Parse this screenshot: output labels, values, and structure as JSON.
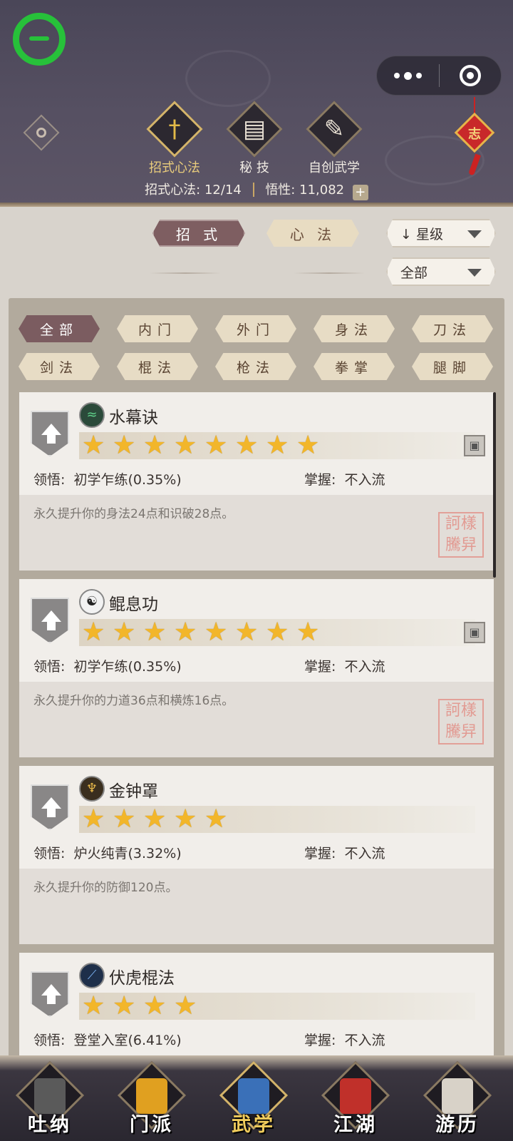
{
  "header": {
    "tabs": [
      {
        "label": "招式心法",
        "glyph": "†",
        "icon": "sword-icon",
        "active": true
      },
      {
        "label": "秘 技",
        "glyph": "▤",
        "icon": "book-icon",
        "active": false
      },
      {
        "label": "自创武学",
        "glyph": "✎",
        "icon": "scroll-icon",
        "active": false
      }
    ],
    "stats": {
      "moves_label": "招式心法:",
      "moves_value": "12/14",
      "insight_label": "悟性:",
      "insight_value": "11,082",
      "plus": "+"
    },
    "knot_char": "志"
  },
  "filters": {
    "type_tabs": [
      {
        "label": "招 式",
        "active": true
      },
      {
        "label": "心 法",
        "active": false
      }
    ],
    "sort": {
      "label": "↓ 星级"
    },
    "scope": {
      "label": "全部"
    }
  },
  "categories": [
    {
      "label": "全部",
      "active": true
    },
    {
      "label": "内门",
      "active": false
    },
    {
      "label": "外门",
      "active": false
    },
    {
      "label": "身法",
      "active": false
    },
    {
      "label": "刀法",
      "active": false
    },
    {
      "label": "剑法",
      "active": false
    },
    {
      "label": "棍法",
      "active": false
    },
    {
      "label": "枪法",
      "active": false
    },
    {
      "label": "拳掌",
      "active": false
    },
    {
      "label": "腿脚",
      "active": false
    }
  ],
  "skills": [
    {
      "name": "水幕诀",
      "icon": "water-icon",
      "stars": 8,
      "comprehension_label": "领悟:",
      "comprehension": "初学乍练(0.35%)",
      "mastery_label": "掌握:",
      "mastery": "不入流",
      "description": "永久提升你的身法24点和识破28点。",
      "has_seal": true,
      "has_book": true
    },
    {
      "name": "鲲息功",
      "icon": "yinyang-icon",
      "stars": 8,
      "comprehension_label": "领悟:",
      "comprehension": "初学乍练(0.35%)",
      "mastery_label": "掌握:",
      "mastery": "不入流",
      "description": "永久提升你的力道36点和横炼16点。",
      "has_seal": true,
      "has_book": true
    },
    {
      "name": "金钟罩",
      "icon": "golden-figure-icon",
      "stars": 5,
      "comprehension_label": "领悟:",
      "comprehension": "炉火纯青(3.32%)",
      "mastery_label": "掌握:",
      "mastery": "不入流",
      "description": "永久提升你的防御120点。",
      "has_seal": false,
      "has_book": false
    },
    {
      "name": "伏虎棍法",
      "icon": "staff-icon",
      "stars": 4,
      "comprehension_label": "领悟:",
      "comprehension": "登堂入室(6.41%)",
      "mastery_label": "掌握:",
      "mastery": "不入流",
      "description": "",
      "has_seal": false,
      "has_book": false
    }
  ],
  "seal_text": "訶樣\n騰舁",
  "bottom_nav": [
    {
      "label": "吐纳",
      "icon": "meditating-figure-icon",
      "color": "#5a5a5a",
      "active": false
    },
    {
      "label": "门派",
      "icon": "banner-icon",
      "color": "#e0a020",
      "active": false
    },
    {
      "label": "武学",
      "icon": "manual-book-icon",
      "color": "#3a70b8",
      "active": true
    },
    {
      "label": "江湖",
      "icon": "hat-icon",
      "color": "#c0302a",
      "active": false
    },
    {
      "label": "游历",
      "icon": "horse-icon",
      "color": "#d8d2c8",
      "active": false
    }
  ]
}
